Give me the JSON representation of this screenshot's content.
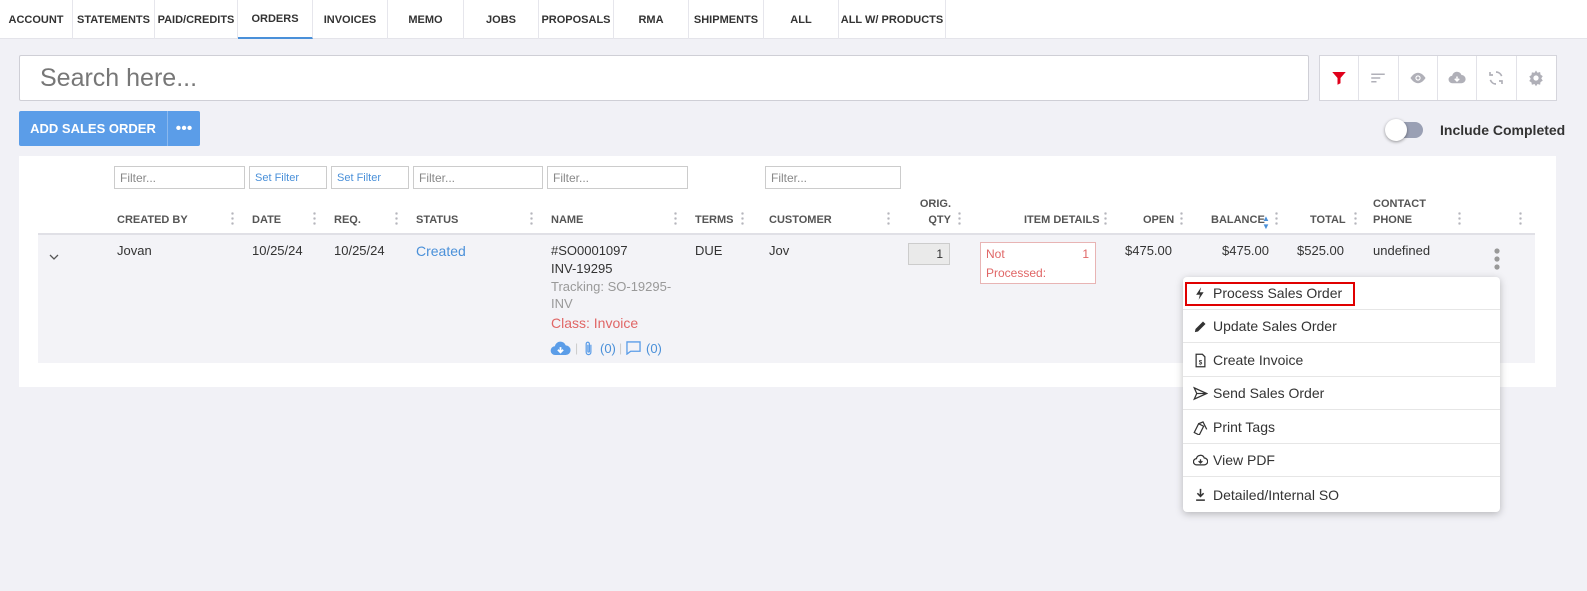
{
  "tabs": [
    {
      "label": "ACCOUNT",
      "active": false
    },
    {
      "label": "STATEMENTS",
      "active": false
    },
    {
      "label": "PAID/CREDITS",
      "active": false
    },
    {
      "label": "ORDERS",
      "active": true
    },
    {
      "label": "INVOICES",
      "active": false
    },
    {
      "label": "MEMO",
      "active": false
    },
    {
      "label": "JOBS",
      "active": false
    },
    {
      "label": "PROPOSALS",
      "active": false
    },
    {
      "label": "RMA",
      "active": false
    },
    {
      "label": "SHIPMENTS",
      "active": false
    },
    {
      "label": "ALL",
      "active": false
    },
    {
      "label": "ALL W/ PRODUCTS",
      "active": false
    }
  ],
  "search": {
    "placeholder": "Search here..."
  },
  "toolbar": {
    "icons": [
      "filter-icon",
      "sort-icon",
      "eye-icon",
      "cloud-download-icon",
      "refresh-icon",
      "gear-icon"
    ],
    "active_color": "#e0001b",
    "inactive_color": "#b0b0b8"
  },
  "actions": {
    "add_label": "ADD SALES ORDER",
    "more_label": "•••",
    "include_completed_label": "Include Completed",
    "include_completed_on": false
  },
  "filters": {
    "created_by": "Filter...",
    "date": "Set Filter",
    "req": "Set Filter",
    "status": "Filter...",
    "name": "Filter...",
    "customer": "Filter..."
  },
  "columns": {
    "created_by": "CREATED BY",
    "date": "DATE",
    "req": "REQ.",
    "status": "STATUS",
    "name": "NAME",
    "terms": "TERMS",
    "customer": "CUSTOMER",
    "orig_qty_1": "ORIG.",
    "orig_qty_2": "QTY",
    "item_details": "ITEM DETAILS",
    "open": "OPEN",
    "balance": "BALANCE",
    "total": "TOTAL",
    "contact_1": "CONTACT",
    "contact_2": "PHONE"
  },
  "row": {
    "created_by": "Jovan",
    "date": "10/25/24",
    "req": "10/25/24",
    "status": "Created",
    "order_number": "#SO0001097",
    "invoice": "INV-19295",
    "tracking_1": "Tracking: SO-19295-",
    "tracking_2": "INV",
    "class": "Class: Invoice",
    "attachments": "(0)",
    "comments": "(0)",
    "terms": "DUE",
    "customer": "Jov",
    "orig_qty": "1",
    "item_status_1": "Not",
    "item_status_2": "Processed:",
    "item_count": "1",
    "open": "$475.00",
    "balance": "$475.00",
    "total": "$525.00",
    "contact_phone": "undefined"
  },
  "menu": {
    "items": [
      {
        "label": "Process Sales Order",
        "icon": "lightning-icon"
      },
      {
        "label": "Update Sales Order",
        "icon": "pencil-icon"
      },
      {
        "label": "Create Invoice",
        "icon": "invoice-document-icon"
      },
      {
        "label": "Send Sales Order",
        "icon": "send-icon"
      },
      {
        "label": "Print Tags",
        "icon": "tags-icon"
      },
      {
        "label": "View PDF",
        "icon": "cloud-download-icon"
      },
      {
        "label": "Detailed/Internal SO",
        "icon": "download-icon"
      }
    ],
    "highlighted_index": 0
  }
}
